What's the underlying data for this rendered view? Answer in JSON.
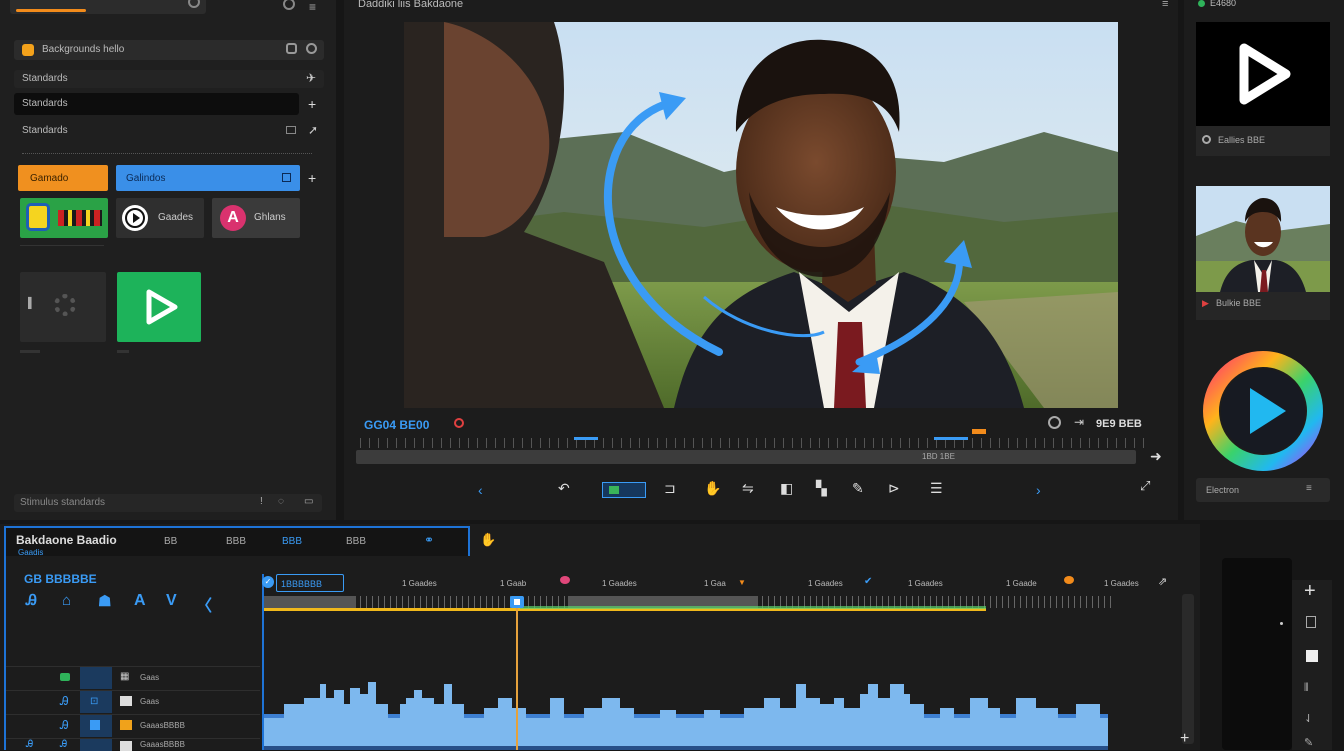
{
  "left_panel": {
    "top_search": "",
    "header_label": "Backgrounds hello",
    "rows": [
      {
        "label": "Standards"
      },
      {
        "label": "Standards"
      },
      {
        "label": "Standards"
      }
    ],
    "orange_button": "Gamado",
    "blue_button": "Galindos",
    "tiles": [
      {
        "label": "Gaades",
        "icon": "play-circle-icon"
      },
      {
        "label": "Ghlans",
        "icon": "letter-a-icon"
      }
    ],
    "bottom_bar": "Stimulus standards"
  },
  "preview": {
    "title": "Daddiki liis Bakdaone",
    "timecode_left": "GG04 BE00",
    "timecode_right": "9E9 BEB",
    "scrub_label": "1BD 1BE",
    "accent_color": "#3a9bf5"
  },
  "right_panel": {
    "top_label": "E4680",
    "thumb1_caption": "Eallies BBE",
    "thumb2_caption": "Bulkie BBE",
    "bottom_field": "Electron"
  },
  "timeline": {
    "title": "Bakdaone Baadio",
    "subtitle": "Gaadis",
    "tabs": [
      "BB",
      "BBB",
      "BBB",
      "BBB"
    ],
    "section_label": "GB BBBBBE",
    "tool_letters": [
      "Ꭿ",
      "⌂",
      "☗",
      "A",
      "V",
      "〈"
    ],
    "active_clip": "1BBBBBB",
    "ruler_labels": [
      "1 Gaades",
      "1 Gaab",
      "1 Gaades",
      "1 Gaa",
      "1 Gaades",
      "1 Gaades",
      "1 Gaade",
      "1 Gaades"
    ],
    "track_labels": [
      "Gaas",
      "Gaas",
      "GaaasBBBB",
      "GaaasBBBB"
    ]
  }
}
